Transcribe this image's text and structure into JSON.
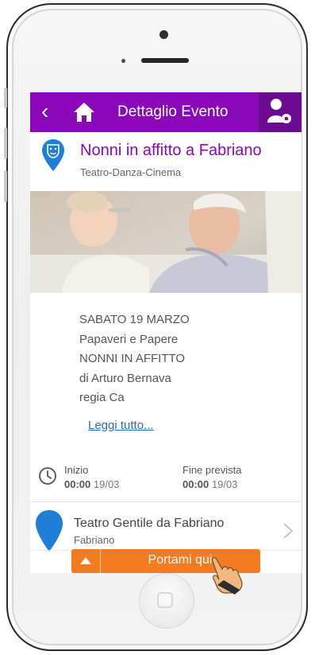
{
  "nav": {
    "back_icon": "chevron-left-icon",
    "home_icon": "home-icon",
    "title": "Dettaglio Evento",
    "user_icon": "user-settings-icon"
  },
  "event": {
    "icon": "theater-mask-pin-icon",
    "title": "Nonni in affitto a Fabriano",
    "category": "Teatro-Danza-Cinema",
    "description": [
      "SABATO 19 MARZO",
      "Papaveri e Papere",
      "NONNI IN AFFITTO",
      "di Arturo Bernava",
      "regia Ca"
    ],
    "read_more": "Leggi tutto..."
  },
  "schedule": {
    "start_label": "Inizio",
    "start_time": "00:00",
    "start_date": "19/03",
    "end_label": "Fine prevista",
    "end_time": "00:00",
    "end_date": "19/03"
  },
  "venue": {
    "name": "Teatro Gentile da Fabriano",
    "city": "Fabriano"
  },
  "cta": {
    "label": "Portami qui"
  },
  "colors": {
    "primary": "#8a08ba",
    "primary_dark": "#6c0a92",
    "accent": "#f47b20",
    "pin_blue": "#1f7fd8",
    "link": "#2a6fba"
  }
}
